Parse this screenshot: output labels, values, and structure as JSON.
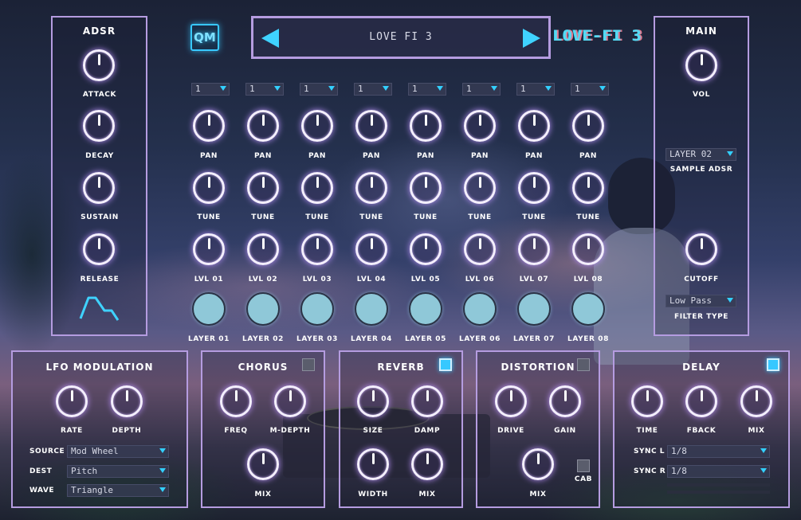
{
  "header": {
    "logo": "QM",
    "preset_name": "LOVE FI 3",
    "brand": "LOVE-FI 3"
  },
  "adsr": {
    "title": "ADSR",
    "knobs": [
      {
        "label": "ATTACK"
      },
      {
        "label": "DECAY"
      },
      {
        "label": "SUSTAIN"
      },
      {
        "label": "RELEASE"
      }
    ]
  },
  "layers": {
    "dropdowns": [
      "1",
      "1",
      "1",
      "1",
      "1",
      "1",
      "1",
      "1"
    ],
    "pan_label": "PAN",
    "tune_label": "TUNE",
    "level_labels": [
      "LVL 01",
      "LVL 02",
      "LVL 03",
      "LVL 04",
      "LVL 05",
      "LVL 06",
      "LVL 07",
      "LVL 08"
    ],
    "pad_labels": [
      "LAYER 01",
      "LAYER 02",
      "LAYER 03",
      "LAYER 04",
      "LAYER 05",
      "LAYER 06",
      "LAYER 07",
      "LAYER 08"
    ]
  },
  "main": {
    "title": "MAIN",
    "vol_label": "VOL",
    "sample_adsr_value": "LAYER 02",
    "sample_adsr_label": "SAMPLE ADSR",
    "cutoff_label": "CUTOFF",
    "filter_value": "Low Pass",
    "filter_label": "FILTER TYPE"
  },
  "lfo": {
    "title": "LFO MODULATION",
    "rate_label": "RATE",
    "depth_label": "DEPTH",
    "source_label": "SOURCE",
    "source_value": "Mod Wheel",
    "dest_label": "DEST",
    "dest_value": "Pitch",
    "wave_label": "WAVE",
    "wave_value": "Triangle"
  },
  "chorus": {
    "title": "CHORUS",
    "freq_label": "FREQ",
    "mdepth_label": "M-DEPTH",
    "mix_label": "MIX",
    "enabled": false
  },
  "reverb": {
    "title": "REVERB",
    "size_label": "SIZE",
    "damp_label": "DAMP",
    "width_label": "WIDTH",
    "mix_label": "MIX",
    "enabled": true
  },
  "distortion": {
    "title": "DISTORTION",
    "drive_label": "DRIVE",
    "gain_label": "GAIN",
    "mix_label": "MIX",
    "cab_label": "CAB",
    "enabled": false,
    "cab_enabled": false
  },
  "delay": {
    "title": "DELAY",
    "time_label": "TIME",
    "fback_label": "FBACK",
    "mix_label": "MIX",
    "sync_l_label": "SYNC L",
    "sync_l_value": "1/8",
    "sync_r_label": "SYNC R",
    "sync_r_value": "1/8",
    "enabled": true
  },
  "colors": {
    "panel_border": "#b59ce0",
    "accent": "#37c8ff",
    "knob_glow": "#be96ff"
  }
}
